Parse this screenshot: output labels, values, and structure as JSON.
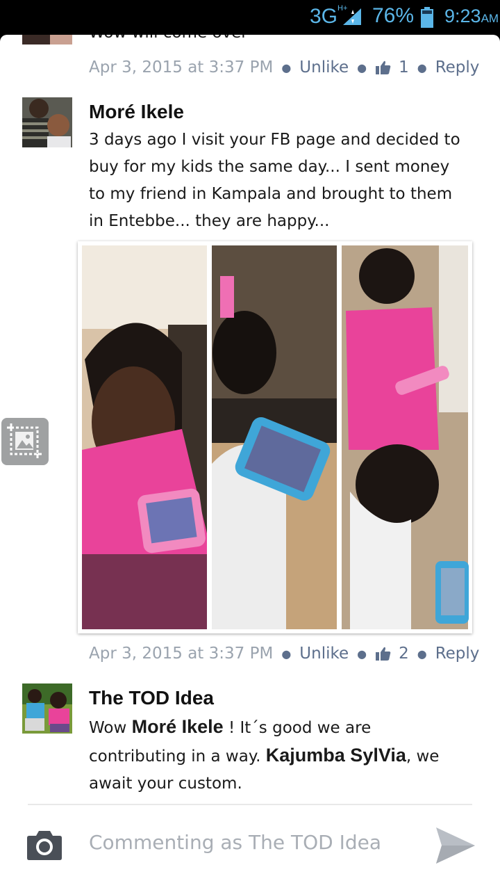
{
  "status_bar": {
    "network": "3G",
    "network_sup": "H+",
    "battery": "76%",
    "time": "9:23",
    "ampm": "AM",
    "accent_color": "#5bb6e8"
  },
  "comments": [
    {
      "text_cut": "Wow will come over",
      "timestamp": "Apr 3, 2015 at 3:37 PM",
      "unlike_label": "Unlike",
      "like_count": "1",
      "reply_label": "Reply"
    },
    {
      "author": "Moré Ikele",
      "text": "3 days ago I visit your FB page and decided to buy for my kids the same day... I sent money to my friend in Kampala and brought to them in Entebbe... they are happy...",
      "timestamp": "Apr 3, 2015 at 3:37 PM",
      "unlike_label": "Unlike",
      "like_count": "2",
      "reply_label": "Reply",
      "photo_desc": "collage-three-photos-children-using-tablets"
    },
    {
      "author": "The TOD Idea",
      "text_parts": [
        "Wow ",
        "Moré Ikele",
        " ! It´s good we are contributing in a way. ",
        "Kajumba SylVia",
        ", we await your custom."
      ]
    }
  ],
  "composer": {
    "placeholder": "Commenting as The TOD Idea",
    "camera_icon": "camera-icon",
    "send_icon": "send-icon"
  },
  "colors": {
    "link": "#5d6f8c",
    "meta": "#9aa3ae",
    "tablet_pink": "#ef6fb4",
    "tablet_blue": "#3fa6d8"
  }
}
